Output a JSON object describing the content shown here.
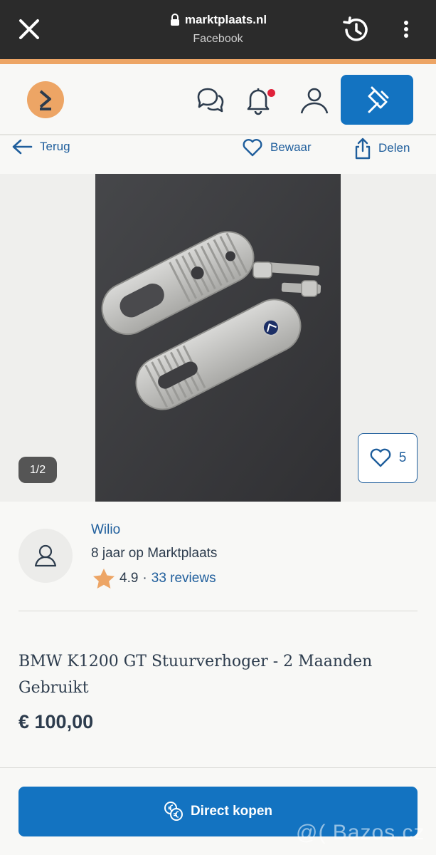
{
  "browser": {
    "domain": "marktplaats.nl",
    "subtitle": "Facebook"
  },
  "header": {
    "icons": [
      "chat-icon",
      "bell-icon",
      "user-icon",
      "pin-icon"
    ],
    "notification": true
  },
  "actions": {
    "back_label": "Terug",
    "save_label": "Bewaar",
    "share_label": "Delen"
  },
  "gallery": {
    "counter": "1/2",
    "favorites": "5"
  },
  "seller": {
    "name": "Wilio",
    "since": "8 jaar op Marktplaats",
    "rating": "4.9",
    "separator": "·",
    "reviews": "33 reviews"
  },
  "listing": {
    "title": "BMW K1200 GT Stuurverhoger - 2 Maanden Gebruikt",
    "price": "€ 100,00"
  },
  "cta": {
    "buy_label": "Direct kopen"
  },
  "watermark": "@( Bazos.cz",
  "colors": {
    "accent": "#eda565",
    "primary": "#1373c1",
    "link": "#1f5e9c",
    "notification": "#e0223a"
  }
}
